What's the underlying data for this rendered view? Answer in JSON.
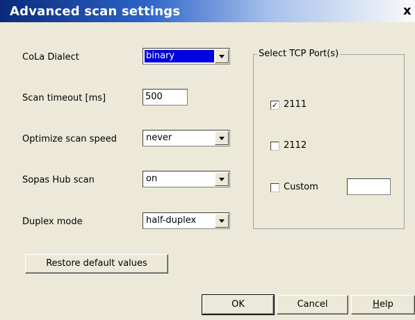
{
  "window": {
    "title": "Advanced scan settings",
    "close_glyph": "x"
  },
  "fields": {
    "cola_dialect": {
      "label": "CoLa Dialect",
      "value": "binary"
    },
    "scan_timeout": {
      "label": "Scan timeout [ms]",
      "value": "500"
    },
    "optimize_scan_speed": {
      "label": "Optimize scan speed",
      "value": "never"
    },
    "sopas_hub_scan": {
      "label": "Sopas Hub scan",
      "value": "on"
    },
    "duplex_mode": {
      "label": "Duplex mode",
      "value": "half-duplex"
    }
  },
  "tcp_ports": {
    "group_label": "Select TCP Port(s)",
    "items": [
      {
        "label": "2111",
        "checked": true
      },
      {
        "label": "2112",
        "checked": false
      },
      {
        "label": "Custom",
        "checked": false,
        "custom_value": ""
      }
    ]
  },
  "buttons": {
    "restore": "Restore default values",
    "ok": "OK",
    "cancel": "Cancel",
    "help_first": "H",
    "help_rest": "elp"
  },
  "check_glyph": "✓"
}
